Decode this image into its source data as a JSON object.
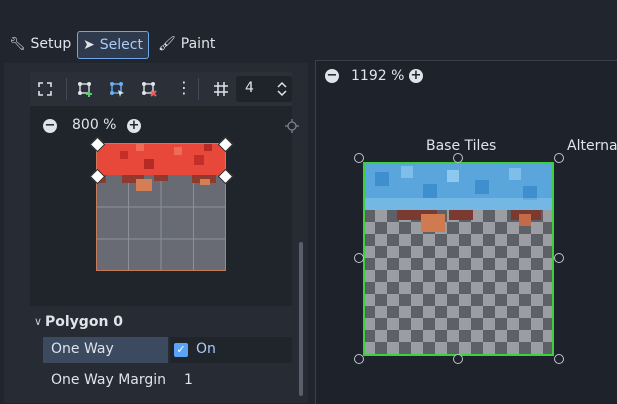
{
  "modes": {
    "setup_label": "Setup",
    "select_label": "Select",
    "paint_label": "Paint"
  },
  "toolbar": {
    "grid_snap_value": "4"
  },
  "left_view": {
    "zoom_label": "800 %"
  },
  "inspector": {
    "section_title": "Polygon 0",
    "one_way_label": "One Way",
    "one_way_value": "On",
    "one_way_margin_label": "One Way Margin",
    "one_way_margin_value": "1"
  },
  "atlas_view": {
    "zoom_label": "1192 %",
    "base_tiles_label": "Base Tiles",
    "alternative_label": "Alternat"
  },
  "colors": {
    "accent": "#70a6e6",
    "selection_outline": "#3ad13a",
    "checkbox": "#5ba3f4"
  }
}
